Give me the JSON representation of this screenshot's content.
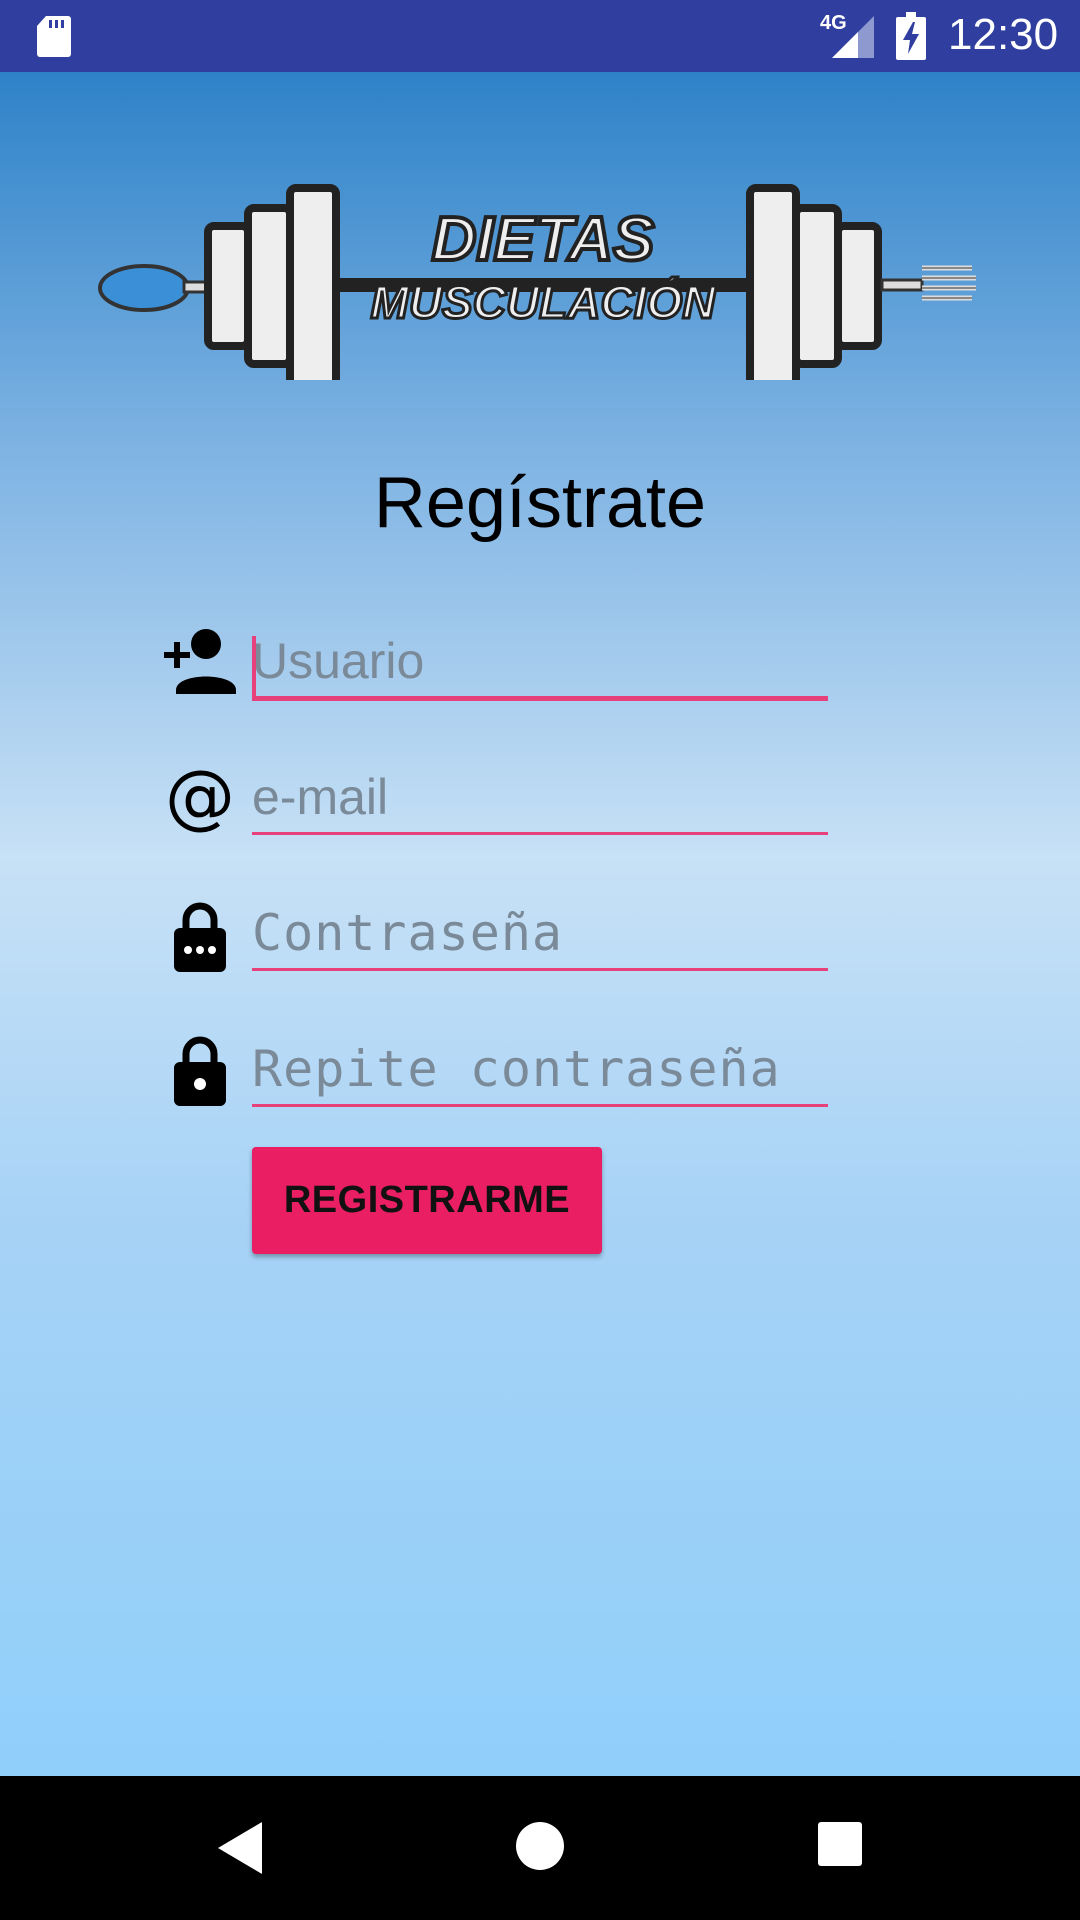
{
  "status_bar": {
    "network": "4G",
    "time": "12:30",
    "icons": [
      "sd-card-icon",
      "signal-icon",
      "battery-charging-icon"
    ]
  },
  "logo": {
    "line1": "DIETAS",
    "line2": "MUSCULACIÓN"
  },
  "form": {
    "title": "Regístrate",
    "fields": [
      {
        "icon": "add-person-icon",
        "placeholder": "Usuario",
        "value": ""
      },
      {
        "icon": "at-sign-icon",
        "placeholder": "e-mail",
        "value": ""
      },
      {
        "icon": "lock-dots-icon",
        "placeholder": "Contraseña",
        "value": ""
      },
      {
        "icon": "lock-icon",
        "placeholder": "Repite contraseña",
        "value": ""
      }
    ],
    "submit_label": "REGISTRARME"
  },
  "nav_bar": {
    "icons": [
      "back-icon",
      "home-icon",
      "recents-icon"
    ]
  },
  "colors": {
    "status_bar": "#303f9f",
    "accent": "#e91e63",
    "underline": "#e8407a",
    "nav_bar": "#000000"
  }
}
